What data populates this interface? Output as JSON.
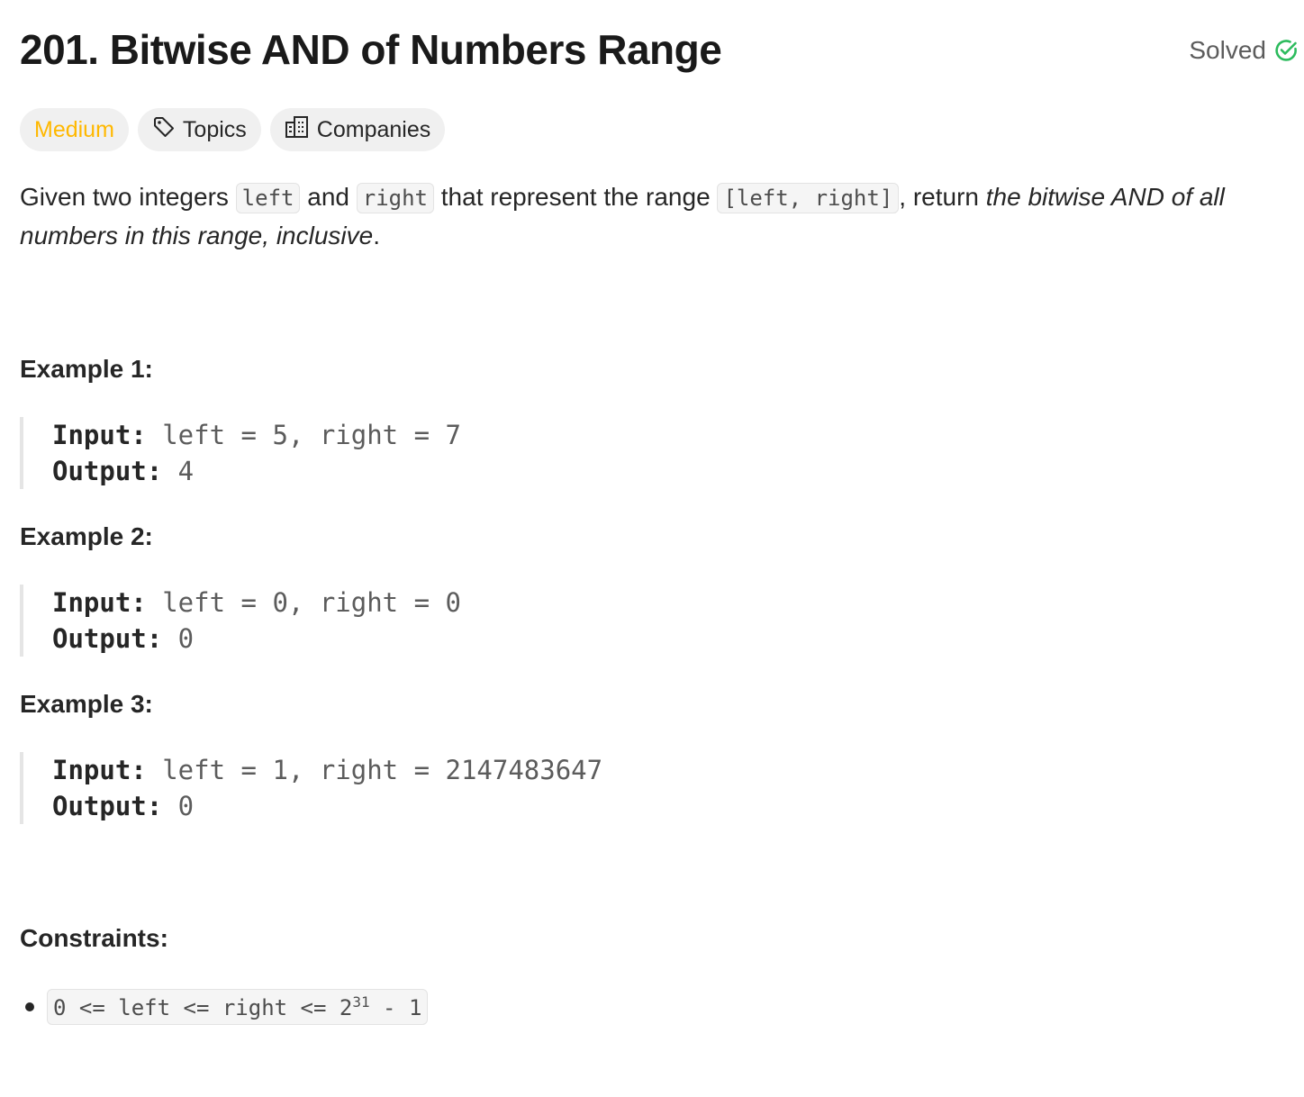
{
  "problem": {
    "title": "201. Bitwise AND of Numbers Range",
    "status_label": "Solved",
    "status_color": "#2cbb5d"
  },
  "tags": {
    "difficulty": "Medium",
    "difficulty_color": "#ffb800",
    "topics_label": "Topics",
    "topics_icon": "tag-icon",
    "companies_label": "Companies",
    "companies_icon": "building-icon"
  },
  "description": {
    "part1": "Given two integers ",
    "code_left": "left",
    "part2": " and ",
    "code_right": "right",
    "part3": " that represent the range ",
    "code_range": "[left, right]",
    "part4": ", return ",
    "emphasis": "the bitwise AND of all numbers in this range, inclusive",
    "part5": "."
  },
  "examples": [
    {
      "heading": "Example 1:",
      "input_label": "Input:",
      "input_value": " left = 5, right = 7",
      "output_label": "Output:",
      "output_value": " 4"
    },
    {
      "heading": "Example 2:",
      "input_label": "Input:",
      "input_value": " left = 0, right = 0",
      "output_label": "Output:",
      "output_value": " 0"
    },
    {
      "heading": "Example 3:",
      "input_label": "Input:",
      "input_value": " left = 1, right = 2147483647",
      "output_label": "Output:",
      "output_value": " 0"
    }
  ],
  "constraints": {
    "heading": "Constraints:",
    "items": [
      {
        "text": "0 <= left <= right <= 2",
        "superscript": "31",
        "suffix": " - 1"
      }
    ]
  }
}
